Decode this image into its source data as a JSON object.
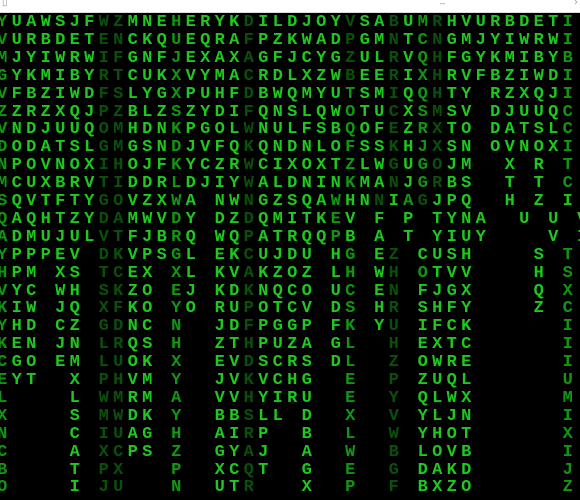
{
  "window": {
    "title_bar_icons": [
      "app-icon",
      "minimize-icon",
      "close-icon"
    ],
    "minimize_glyph": "_",
    "close_glyph": "›",
    "left_glyph": "▯"
  },
  "colors": {
    "background": "#000000",
    "bright": "#1ec81e",
    "mid": "#129612",
    "dim": "#0a500a"
  },
  "matrix": {
    "rows": [
      {
        "text": "YUAWSJFWZMNEHERYKDILDJOYVSABUMRHVURBDETI",
        "shade": "mbbbbbbddbbbmbbbbdbbbbbbdbbdbmdbbbbbbbbm"
      },
      {
        "text": "VURBDETENCKQUEQRAFPZKWADPGMNTCNGMJYIWRWI",
        "shade": "mbbbbbbddbbbmbbbbdbbbbbbdbbdbmdbbbbbbbbm"
      },
      {
        "text": "MJYIWRWIFGNFJEXAXAGFJCYGZULRVQHFGYKMIBYB",
        "shade": "mbbbbbbddbbbmbbbbdbbbbbbdbbdbmdbbbbbbbbm"
      },
      {
        "text": "GYKMIBYRTCUKXVYMACRDLXZWBEERIXHRVFBZIWDI",
        "shade": "mbbbbbbddbbbmbbbbdbbbbbbdbbdbmdbbbbbbbbm"
      },
      {
        "text": "VFBZIWDFSLYGXPUHFDBWQMYUTSMIQQHTY RZXQJI",
        "shade": "mbbbbbbddbbbmbbbbdbbbbbbmbbdbmdbb bbbbbm"
      },
      {
        "text": "ZZRZXQJPZBLZSZYDIFQNSLQWOTUCXSMSV DJUUQC",
        "shade": "mbbbbbbddbbbmbbbbdbbbbbbmbbdbmdbb bbbbbm"
      },
      {
        "text": "VNDJUUQOMHDNKPGOLWNULFSBQOFEZRXTO DATSLC",
        "shade": "mbbbbbbddbbbmbbbbdbbbbbbmbbdbmdbb bbbbbm"
      },
      {
        "text": "DODATSLGMGSNDJVFQKQNDNLOFSSKHJXSN OVNOXI",
        "shade": "mbbbbbbddbbbmbbbbdbbbbbbmbbdbmdbb bbbbbm"
      },
      {
        "text": "NPOVNOXIHOJFKYCZRWCIXOXTZLWGUGOJM  X R T",
        "shade": "mbbbbbbddbbbmbbbbdbbbbbbmbbdbmdbb  b b m"
      },
      {
        "text": "MCUXBRVTIDDRLDJIYWALDNINKMANJGRBS  T T C",
        "shade": "mbbbbbbddbbbmbbbbdbbbbbbmbbdbmdbb  b b m"
      },
      {
        "text": "SQVTFTYGOVZXWA NWNGZSQAWHNNIAGJPQ  H Z I",
        "shade": "mbbbbbbddbbbmb bbdbbbbbmbbdbmdbb  b b m"
      },
      {
        "text": "QAQHTZYDAMWVDY DZDQMITKEV F P TYNA  U U V",
        "shade": "mbbbbbbddbbbmb bbdbbbbbm b d bbbb  b b m"
      },
      {
        "text": "ADMUJULVTFJBRQ WQPATRQQPB A T YIUY    V I",
        "shade": "mbbbbbbddbbbmb bbdbbbbbm b d bbbb    b m"
      },
      {
        "text": "YPPPEV DKVPSGL EKCUJDU HG EZ CUSH    S T",
        "shade": "mbbbbb ddbbbmb bbdbbbb bm bd bbbb    b m"
      },
      {
        "text": "HPM XS TCEX XL KVAKZOZ LH WH OTVV    H S",
        "shade": "mbb bb ddbb mb bbdbbbb bm bd mbbb    b m"
      },
      {
        "text": "VYC WH SKZO EJ KDKNQCO UC EN FJGX    Q X",
        "shade": "mbb bb ddbb mb bbdbbbb bm bd bbbb    b m"
      },
      {
        "text": "KIW JQ XFKO YO RUPOTCV DS HR SHFY    Z C",
        "shade": "mbb bb ddbb mb bbdbbbb bm bd bbbb    b m"
      },
      {
        "text": "YHD CZ GDNC N  JDFPGGP FK YU IFCK      I",
        "shade": "mbb bb ddbb m  bbdbbbb bm bd bbbb      m"
      },
      {
        "text": "KEN JN LRQS H  ZTHPUZA GL  H EXTC      I",
        "shade": "mbb bb ddbb m  bbdbbbb bm  d bbbb      m"
      },
      {
        "text": "CGO EM LUOK X  EVDSCRS DL  Z OWRE      I",
        "shade": "mbb bb ddbb m  bbdbbbb bm  d bbbb      m"
      },
      {
        "text": "EYT  X PHVM Y  JVKVCHG  E  P ZUQL      U",
        "shade": "mbb  b ddbb m  bbdbbbb  m  d bbbb      m"
      },
      {
        "text": "L    L WMRM A  VVHYIRU  E  Y QLWX      M",
        "shade": "m    b ddbb m  bbdbbbb  m  d bbbb      m"
      },
      {
        "text": "X    S MWDK Y  BBSLL D  X  V YLJN      I",
        "shade": "m    b ddbb m  bbdbb b  m  d bbbb      m"
      },
      {
        "text": "N    C IUAG H  AIRP  B  L  W YHOT      X",
        "shade": "m    b ddbb m  bbdb  b  m  d bbbb      m"
      },
      {
        "text": "C    A XCPS Z  GYAJ  A  W  B LOVB      I",
        "shade": "m    b ddbb m  bbdb  b  m  d bbbb      m"
      },
      {
        "text": "B    T PX   P  XCQT  G  E  G DAKD      J",
        "shade": "m    b dd   m  bbdb  b  m  d bbbb      m"
      },
      {
        "text": "O    I JU   N  UTR   X  P  F BXZO      Z",
        "shade": "m    b dd   m  bbd   b  m  d bbbb      m"
      }
    ]
  }
}
